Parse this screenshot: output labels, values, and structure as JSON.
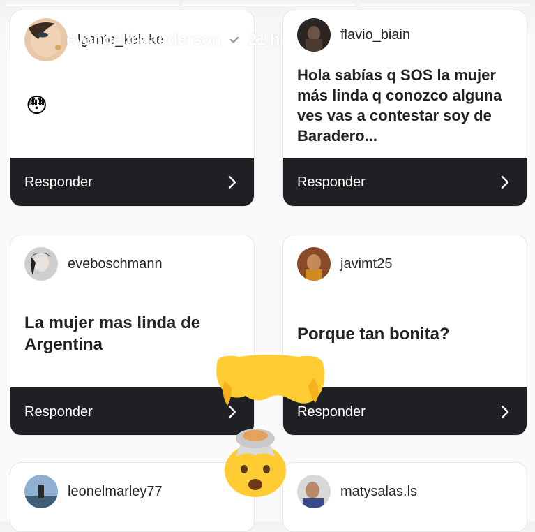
{
  "story": {
    "account": "evangelinaanderson",
    "time": "21 h",
    "progress": [
      1.0,
      1.0,
      0.0
    ]
  },
  "cards": [
    {
      "username": "lgante_keloke",
      "message": "",
      "emoji": "😳",
      "reply_label": "Responder"
    },
    {
      "username": "flavio_biain",
      "message": "Hola sabías q SOS la mujer más linda q conozco alguna ves vas a contestar soy de Baradero...",
      "reply_label": "Responder"
    },
    {
      "username": "eveboschmann",
      "message": "La mujer mas linda de Argentina",
      "reply_label": "Responder"
    },
    {
      "username": "javimt25",
      "message": "Porque tan bonita?",
      "reply_label": "Responder"
    },
    {
      "username": "leonelmarley77"
    },
    {
      "username": "matysalas.ls"
    }
  ],
  "icons": {
    "verified": "verified-badge-icon",
    "more": "more-horizontal-icon",
    "close": "close-icon",
    "chevron": "chevron-right-icon",
    "sticker": "exploding-head-emoji"
  },
  "colors": {
    "reply_bar": "#1f2024",
    "card_bg": "#ffffff",
    "text": "#262626"
  }
}
